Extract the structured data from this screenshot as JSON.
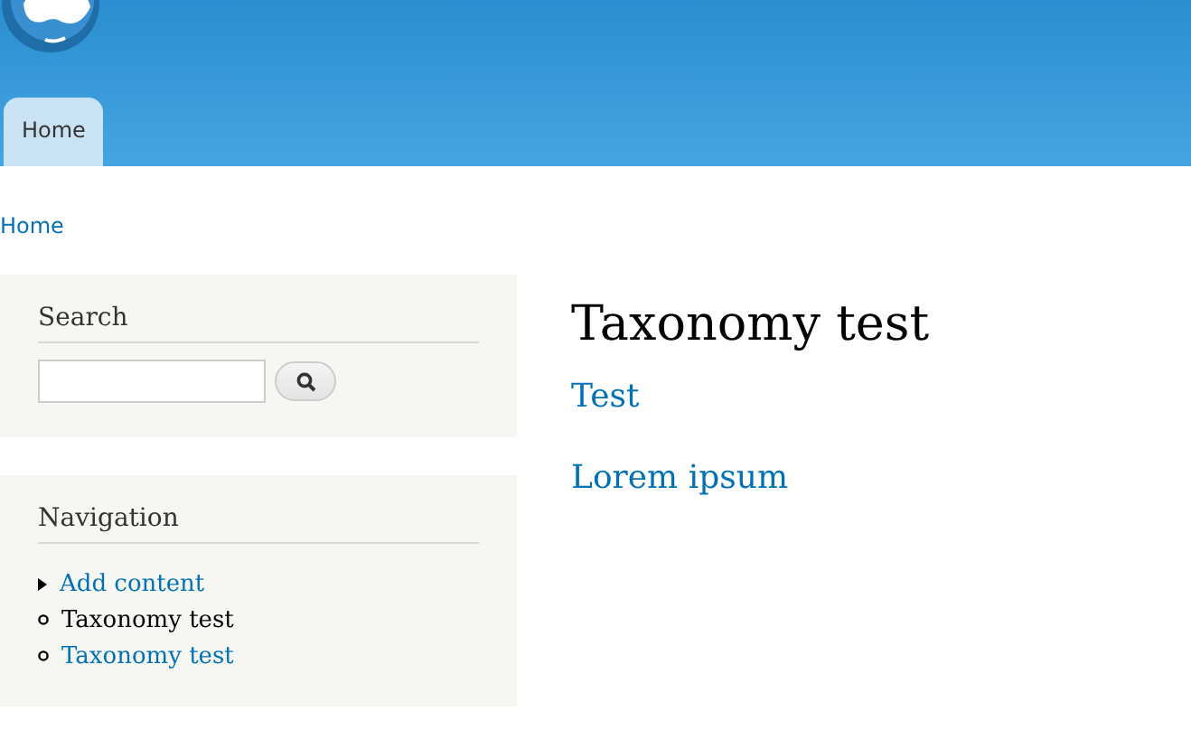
{
  "header": {
    "tabs": [
      {
        "label": "Home",
        "selected": true
      }
    ]
  },
  "breadcrumb": [
    "Home"
  ],
  "sidebar": {
    "search": {
      "title": "Search"
    },
    "navigation": {
      "title": "Navigation",
      "items": [
        {
          "label": "Add content",
          "kind": "collapsed",
          "active": false
        },
        {
          "label": "Taxonomy test",
          "kind": "leaf",
          "active": true
        },
        {
          "label": "Taxonomy test",
          "kind": "leaf",
          "active": false
        }
      ]
    }
  },
  "main": {
    "title": "Taxonomy test",
    "nodes": [
      "Test",
      "Lorem ipsum"
    ]
  }
}
